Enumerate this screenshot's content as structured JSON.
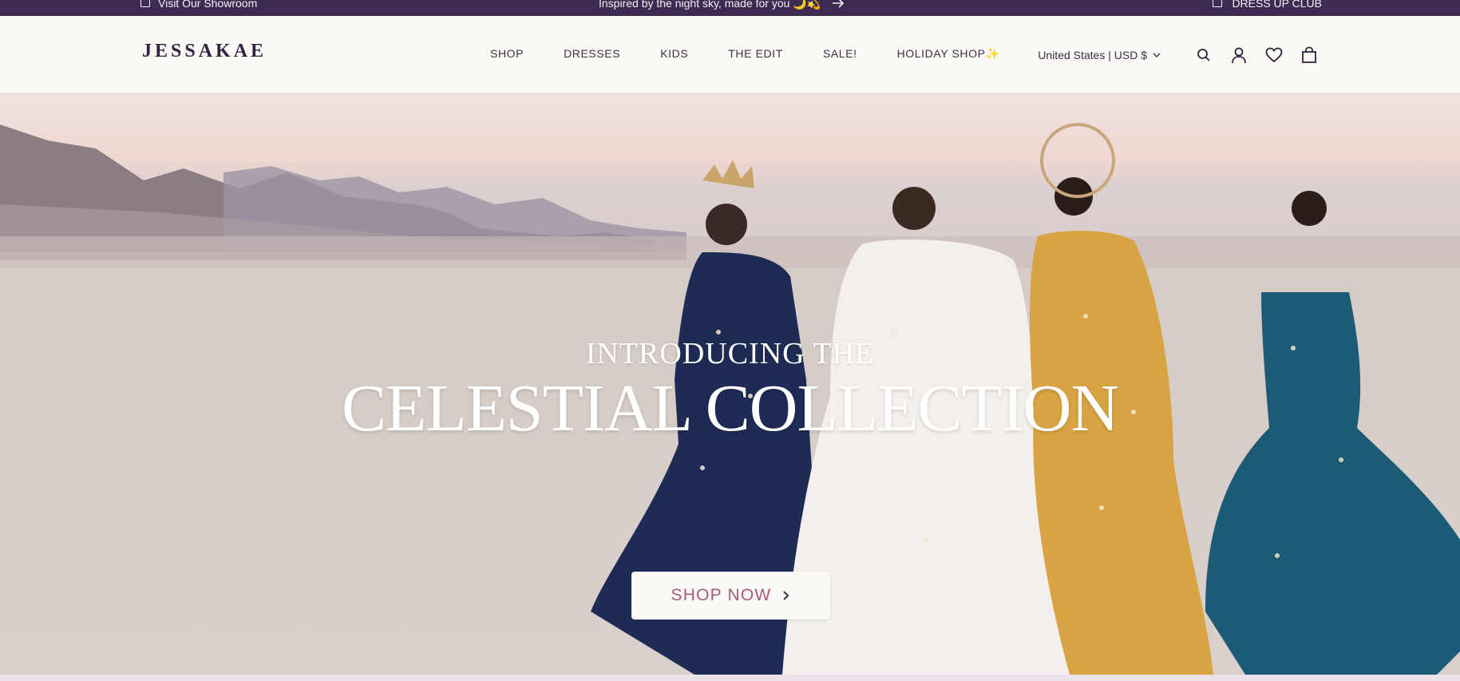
{
  "announcement": {
    "left_text": "Visit Our Showroom",
    "center_text": "Inspired by the night sky, made for you 🌙💫",
    "right_text": "DRESS UP CLUB"
  },
  "header": {
    "logo": "JESSAKAE",
    "nav": [
      "SHOP",
      "DRESSES",
      "KIDS",
      "THE EDIT",
      "SALE!",
      "HOLIDAY SHOP✨"
    ],
    "region": "United States | USD $"
  },
  "hero": {
    "subtitle": "INTRODUCING THE",
    "title": "CELESTIAL COLLECTION",
    "cta": "SHOP NOW"
  },
  "colors": {
    "announcement_bg": "#3d2b52",
    "header_bg": "#fbf9f5",
    "cta_text": "#a65a7f"
  },
  "icons": [
    "store-icon",
    "arrow-right-icon",
    "chevron-down-icon",
    "search-icon",
    "account-icon",
    "heart-icon",
    "bag-icon",
    "chevron-right-icon"
  ]
}
